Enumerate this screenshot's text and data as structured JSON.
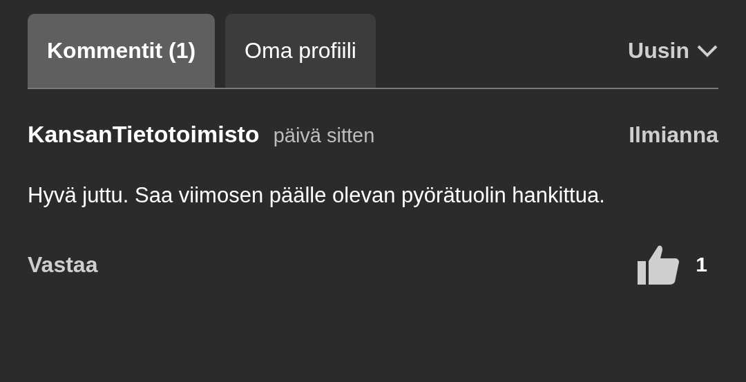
{
  "tabs": [
    {
      "label": "Kommentit (1)",
      "selected": true
    },
    {
      "label": "Oma profiili",
      "selected": false
    }
  ],
  "sort": {
    "label": "Uusin"
  },
  "comments": [
    {
      "author": "KansanTietotoimisto",
      "time": "päivä sitten",
      "report": "Ilmianna",
      "text": "Hyvä juttu. Saa viimosen päälle olevan pyörätuolin hankittua.",
      "reply": "Vastaa",
      "likes": "1"
    }
  ]
}
